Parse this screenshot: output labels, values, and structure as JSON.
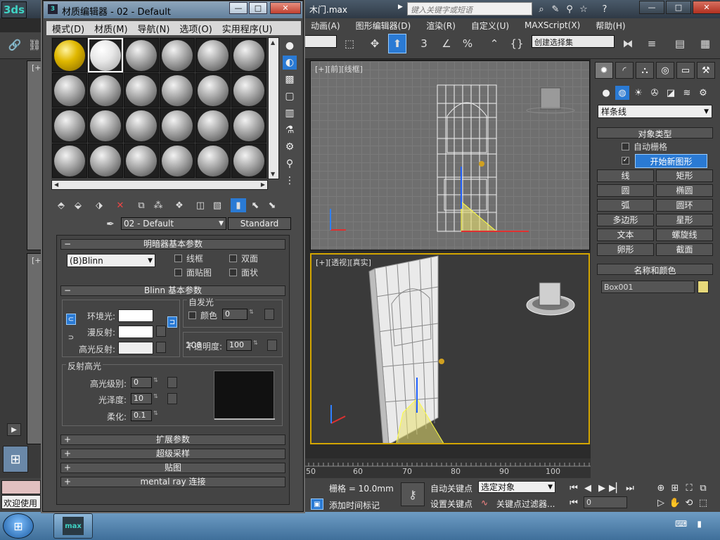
{
  "window": {
    "doc_title": "木门.max",
    "search_placeholder": "键入关键字或短语",
    "app_logo": "3ds",
    "win_buttons": [
      "—",
      "□",
      "✕"
    ]
  },
  "main_menu": [
    "动画(A)",
    "图形编辑器(D)",
    "渲染(R)",
    "自定义(U)",
    "MAXScript(X)",
    "帮助(H)"
  ],
  "main_toolbar": {
    "selection_set": "创建选择集"
  },
  "viewports": {
    "front_label": "[+][前][线框]",
    "persp_label": "[+][透视][真实]",
    "left_label_top": "[+",
    "left_label_bottom": "[+"
  },
  "command_panel": {
    "category": "样条线",
    "object_type_header": "对象类型",
    "auto_grid": "自动栅格",
    "start_new_shape": "开始新图形",
    "start_new_shape_checked": true,
    "objects": [
      "线",
      "矩形",
      "圆",
      "椭圆",
      "弧",
      "圆环",
      "多边形",
      "星形",
      "文本",
      "螺旋线",
      "卵形",
      "截面"
    ],
    "name_color_header": "名称和颜色",
    "object_name": "Box001",
    "object_color": "#e6d87a"
  },
  "material_editor": {
    "title": "材质编辑器 - 02 - Default",
    "menu": [
      "模式(D)",
      "材质(M)",
      "导航(N)",
      "选项(O)",
      "实用程序(U)"
    ],
    "material_name": "02 - Default",
    "material_type": "Standard",
    "slots": 24,
    "selected_slot": 1,
    "shader_basic": {
      "header": "明暗器基本参数",
      "shader": "(B)Blinn",
      "wire": "线框",
      "two_sided": "双面",
      "face_map": "面贴图",
      "faceted": "面状"
    },
    "blinn_basic": {
      "header": "Blinn 基本参数",
      "ambient": "环境光:",
      "diffuse": "漫反射:",
      "specular": "高光反射:",
      "self_illum_group": "自发光",
      "color_chk": "颜色",
      "self_illum_value": "0",
      "opacity_label": "不透明度:",
      "opacity_value": "100"
    },
    "specular_highlights": {
      "group": "反射高光",
      "level_label": "高光级别:",
      "level_value": "0",
      "gloss_label": "光泽度:",
      "gloss_value": "10",
      "soften_label": "柔化:",
      "soften_value": "0.1"
    },
    "rollouts": [
      "扩展参数",
      "超级采样",
      "贴图",
      "mental ray 连接"
    ]
  },
  "timeline": {
    "ticks": [
      "50",
      "60",
      "70",
      "80",
      "90",
      "100"
    ]
  },
  "status": {
    "welcome": "欢迎使用",
    "grid": "栅格 = 10.0mm",
    "add_time_tag": "添加时间标记",
    "auto_key": "自动关键点",
    "set_key": "设置关键点",
    "selected_obj": "选定对象",
    "key_filters": "关键点过滤器...",
    "frame": "0"
  },
  "taskbar": {
    "task_label": "max"
  }
}
